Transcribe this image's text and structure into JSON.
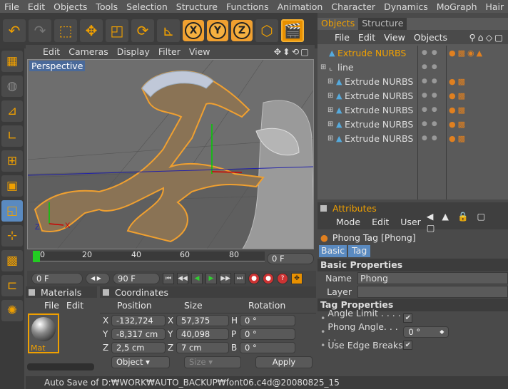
{
  "menu": [
    "File",
    "Edit",
    "Objects",
    "Tools",
    "Selection",
    "Structure",
    "Functions",
    "Animation",
    "Character",
    "Dynamics",
    "MoGraph",
    "Hair"
  ],
  "toolbar": {
    "axis_x": "X",
    "axis_y": "Y",
    "axis_z": "Z"
  },
  "viewport": {
    "menu": [
      "Edit",
      "Cameras",
      "Display",
      "Filter",
      "View"
    ],
    "label": "Perspective"
  },
  "timeline": {
    "ticks": [
      "0",
      "20",
      "40",
      "60",
      "80"
    ],
    "current_frame": "0 F",
    "start_frame": "0 F",
    "end_frame": "90 F"
  },
  "materials": {
    "title": "Materials",
    "menu": [
      "File",
      "Edit"
    ],
    "items": [
      {
        "name": "Mat"
      }
    ]
  },
  "coordinates": {
    "title": "Coordinates",
    "headers": [
      "Position",
      "Size",
      "Rotation"
    ],
    "rows": [
      {
        "pos_label": "X",
        "pos": "-132,724 cm",
        "size_label": "X",
        "size": "57,375 cm",
        "rot_label": "H",
        "rot": "0 °"
      },
      {
        "pos_label": "Y",
        "pos": "-8,317 cm",
        "size_label": "Y",
        "size": "40,098 cm",
        "rot_label": "P",
        "rot": "0 °"
      },
      {
        "pos_label": "Z",
        "pos": "2,5 cm",
        "size_label": "Z",
        "size": "7 cm",
        "rot_label": "B",
        "rot": "0 °"
      }
    ],
    "mode": "Object",
    "size_mode": "Size",
    "apply": "Apply"
  },
  "status": "Auto Save of D:₩WORK₩AUTO_BACKUP₩font06.c4d@20080825_15",
  "objects": {
    "tabs": [
      "Objects",
      "Structure"
    ],
    "menu": [
      "File",
      "Edit",
      "View",
      "Objects"
    ],
    "items": [
      {
        "name": "Extrude NURBS",
        "selected": true,
        "indent": 0
      },
      {
        "name": "line",
        "selected": false,
        "indent": 0
      },
      {
        "name": "Extrude NURBS",
        "selected": false,
        "indent": 1
      },
      {
        "name": "Extrude NURBS",
        "selected": false,
        "indent": 1
      },
      {
        "name": "Extrude NURBS",
        "selected": false,
        "indent": 1
      },
      {
        "name": "Extrude NURBS",
        "selected": false,
        "indent": 1
      },
      {
        "name": "Extrude NURBS",
        "selected": false,
        "indent": 1
      }
    ]
  },
  "attributes": {
    "title": "Attributes",
    "menu": [
      "Mode",
      "Edit",
      "User"
    ],
    "tag_name": "Phong Tag [Phong]",
    "tabs": [
      "Basic",
      "Tag"
    ],
    "basic_header": "Basic Properties",
    "name_label": "Name",
    "name_value": "Phong",
    "layer_label": "Layer",
    "tag_header": "Tag Properties",
    "angle_limit_label": "Angle Limit . . . . . .",
    "phong_angle_label": "Phong Angle. . . . .",
    "phong_angle_value": "0 °",
    "edge_breaks_label": "Use Edge Breaks",
    "check": "✔"
  },
  "colors": {
    "accent": "#f0a000",
    "selection": "#5a8ac0"
  }
}
